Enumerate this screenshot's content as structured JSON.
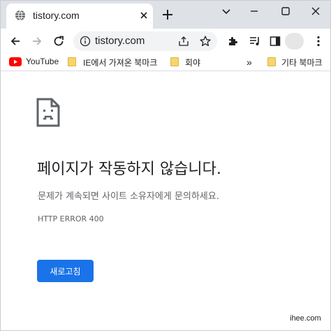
{
  "tab": {
    "title": "tistory.com"
  },
  "omnibox": {
    "url": "tistory.com"
  },
  "bookmarks": {
    "items": [
      {
        "label": "YouTube"
      },
      {
        "label": "IE에서 가져온 북마크"
      },
      {
        "label": "회야"
      }
    ],
    "overflow": "»",
    "other": "기타 북마크"
  },
  "error": {
    "heading": "페이지가 작동하지 않습니다.",
    "message": "문제가 계속되면 사이트 소유자에게 문의하세요.",
    "code": "HTTP ERROR 400",
    "reload_label": "새로고침"
  },
  "watermark": "ihee.com",
  "colors": {
    "tabstrip": "#dee1e6",
    "accent": "#1a73e8",
    "youtube": "#ff0000",
    "folder": "#f7d56b"
  }
}
